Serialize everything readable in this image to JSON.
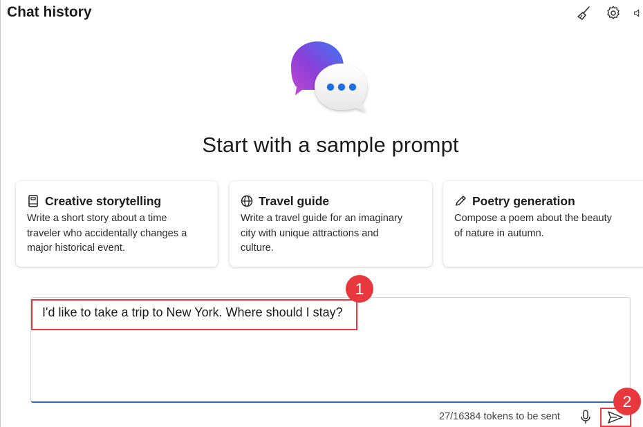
{
  "header": {
    "title": "Chat history",
    "icons": [
      "broom-icon",
      "settings-gear-icon",
      "speaker-icon"
    ]
  },
  "hero": {
    "title": "Start with a sample prompt"
  },
  "cards": [
    {
      "icon": "book-icon",
      "title": "Creative storytelling",
      "desc_lines": [
        "Write a short story about a time",
        "traveler who accidentally changes a",
        "major historical event."
      ]
    },
    {
      "icon": "globe-icon",
      "title": "Travel guide",
      "desc_lines": [
        "Write a travel guide for an imaginary",
        "city with unique attractions and",
        "culture."
      ]
    },
    {
      "icon": "pencil-icon",
      "title": "Poetry generation",
      "desc_lines": [
        "Compose a poem about the beauty",
        "of nature in autumn."
      ]
    }
  ],
  "input": {
    "value": "I'd like to take a trip to New York. Where should I stay?"
  },
  "footer": {
    "token_count": "27/16384 tokens to be sent"
  },
  "annotations": {
    "badge1": "1",
    "badge2": "2",
    "color": "#e8383d"
  },
  "colors": {
    "accent": "#2a6ac7",
    "logo_gradient": [
      "#3a78f2",
      "#8b3fd9",
      "#c24ad0"
    ],
    "dots": "#1e6fe0"
  }
}
